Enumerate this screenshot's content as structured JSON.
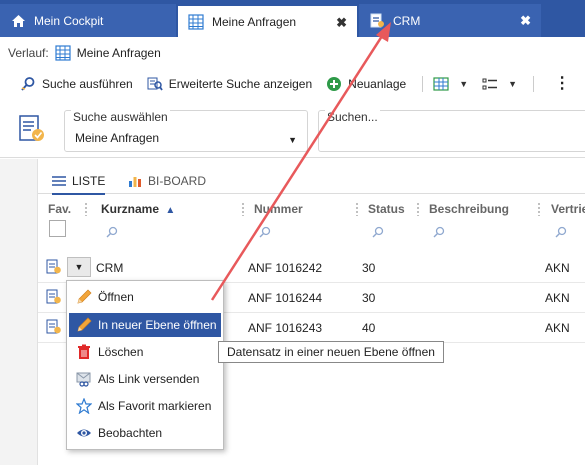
{
  "tabs": [
    {
      "label": "Mein Cockpit",
      "icon": "home-icon"
    },
    {
      "label": "Meine Anfragen",
      "icon": "grid-icon"
    },
    {
      "label": "CRM",
      "icon": "crm-record-icon"
    }
  ],
  "tab_close_glyph": "✖",
  "history": {
    "label": "Verlauf:",
    "item": "Meine Anfragen"
  },
  "toolbar": {
    "search_label": "Suche ausführen",
    "advanced_label": "Erweiterte Suche anzeigen",
    "new_label": "Neuanlage"
  },
  "search": {
    "select_label": "Suche auswählen",
    "select_value": "Meine Anfragen",
    "field_label": "Suchen..."
  },
  "views": {
    "list": "LISTE",
    "board": "BI-BOARD"
  },
  "columns": {
    "fav": "Fav.",
    "kurzname": "Kurzname",
    "nummer": "Nummer",
    "status": "Status",
    "beschreibung": "Beschreibung",
    "vertrieb": "Vertrie"
  },
  "rows": [
    {
      "kurzname": "CRM",
      "nummer": "ANF 1016242",
      "status": "30",
      "vertrieb": "AKN"
    },
    {
      "kurzname": "",
      "nummer": "ANF 1016244",
      "status": "30",
      "vertrieb": "AKN"
    },
    {
      "kurzname": "",
      "nummer": "ANF 1016243",
      "status": "40",
      "vertrieb": "AKN"
    }
  ],
  "context_menu": [
    {
      "label": "Öffnen",
      "icon": "pencil-icon"
    },
    {
      "label": "In neuer Ebene öffnen",
      "icon": "pencil-icon",
      "active": true
    },
    {
      "label": "Löschen",
      "icon": "trash-icon"
    },
    {
      "label": "Als Link versenden",
      "icon": "mail-link-icon"
    },
    {
      "label": "Als Favorit markieren",
      "icon": "star-icon"
    },
    {
      "label": "Beobachten",
      "icon": "eye-icon"
    }
  ],
  "tooltip": "Datensatz in einer neuen Ebene öffnen",
  "colors": {
    "accent": "#2f57a3",
    "annotation_arrow": "#e8595b"
  }
}
